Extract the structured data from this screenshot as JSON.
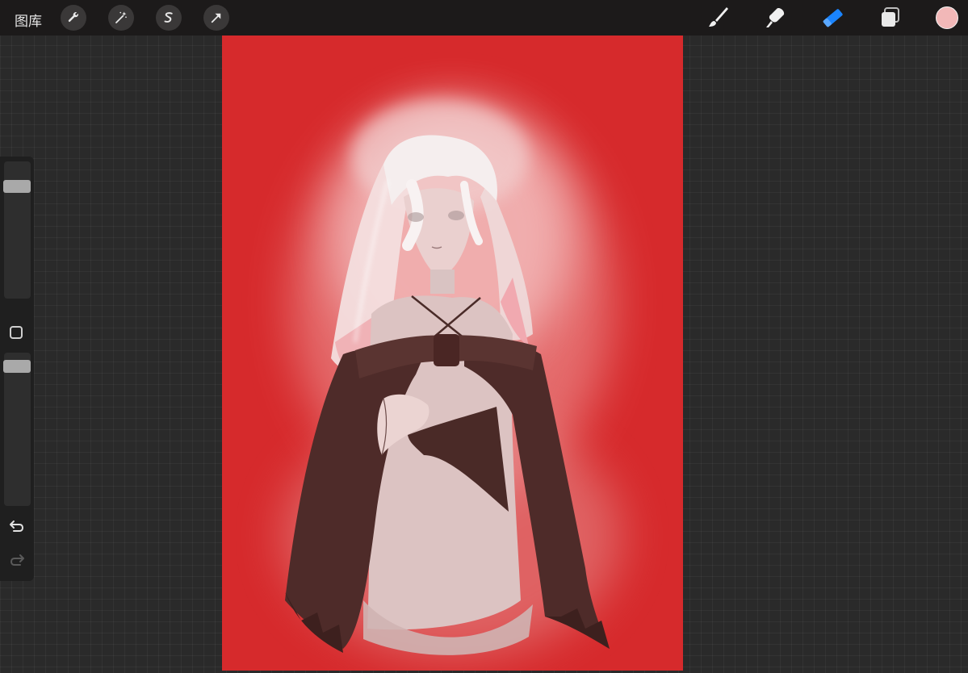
{
  "topbar": {
    "gallery_label": "图库",
    "left_tools": [
      "wrench-icon",
      "magic-wand-icon",
      "selection-icon",
      "transform-arrow-icon"
    ],
    "right_tools": [
      "brush-icon",
      "smudge-icon",
      "eraser-icon",
      "layers-icon"
    ],
    "active_tool": "eraser-icon",
    "current_color": "#f2b8b8",
    "accent_color": "#1a84ff"
  },
  "sidebar": {
    "brush_size": 0.15,
    "opacity": 0.05,
    "controls": [
      "brush-size-slider",
      "modify-button",
      "opacity-slider",
      "undo-icon",
      "redo-icon"
    ]
  },
  "canvas": {
    "background_color": "#d62a2c",
    "content": "artwork"
  }
}
